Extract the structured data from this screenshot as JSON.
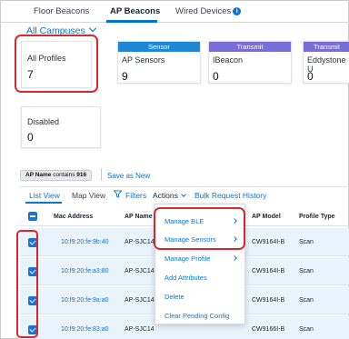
{
  "tabs": [
    {
      "label": "Floor Beacons"
    },
    {
      "label": "AP Beacons"
    },
    {
      "label": "Wired Devices"
    }
  ],
  "campus": {
    "label": "All Campuses"
  },
  "cards": {
    "all_profiles": {
      "label": "All Profiles",
      "value": "7"
    },
    "sensor": {
      "header": "Sensor",
      "label": "AP Sensors",
      "value": "9",
      "color": "#1f86d6"
    },
    "ibeacon": {
      "header": "Transmit",
      "label": "IBeacon",
      "value": "0",
      "color": "#7b6dd9"
    },
    "eddystone": {
      "header": "Transmit",
      "label": "Eddystone U",
      "value": "0",
      "color": "#7b6dd9"
    },
    "disabled": {
      "label": "Disabled",
      "value": "0"
    }
  },
  "filter": {
    "chip_field": "AP Name",
    "chip_op": "contains",
    "chip_value": "916",
    "save_new": "Save as New"
  },
  "subtabs": {
    "list": "List View",
    "map": "Map View"
  },
  "toolbar": {
    "filters": "Filters",
    "actions": "Actions",
    "bulk": "Bulk Request History"
  },
  "table": {
    "columns": [
      "Mac Address",
      "AP Name",
      "AP Model",
      "Profile Type"
    ],
    "rows": [
      {
        "mac": "10:f9:20:fe:9b:40",
        "ap_name": "AP-SJC14",
        "model": "CW9164I-B",
        "profile": "Scan"
      },
      {
        "mac": "10:f9:20:fe:a3:80",
        "ap_name": "AP-SJC14",
        "model": "CW9164I-B",
        "profile": "Scan"
      },
      {
        "mac": "10:f9:20:fe:9a:a0",
        "ap_name": "AP-SJC14",
        "model": "CW9164I-B",
        "profile": "Scan"
      },
      {
        "mac": "10:f9:20:fe:83:a0",
        "ap_name": "AP-SJC14",
        "model": "CW9166I-B",
        "profile": "Scan"
      }
    ]
  },
  "actions_menu": {
    "manage_ble": "Manage BLE",
    "manage_sensors": "Manage Sensors",
    "manage_profile": "Manage Profile",
    "add_attributes": "Add Attributes",
    "delete": "Delete",
    "clear_pending": "Clear Pending Config"
  },
  "colors": {
    "accent": "#0a76d0",
    "highlight": "#d6282e",
    "row_selected": "#e9f3fb"
  }
}
